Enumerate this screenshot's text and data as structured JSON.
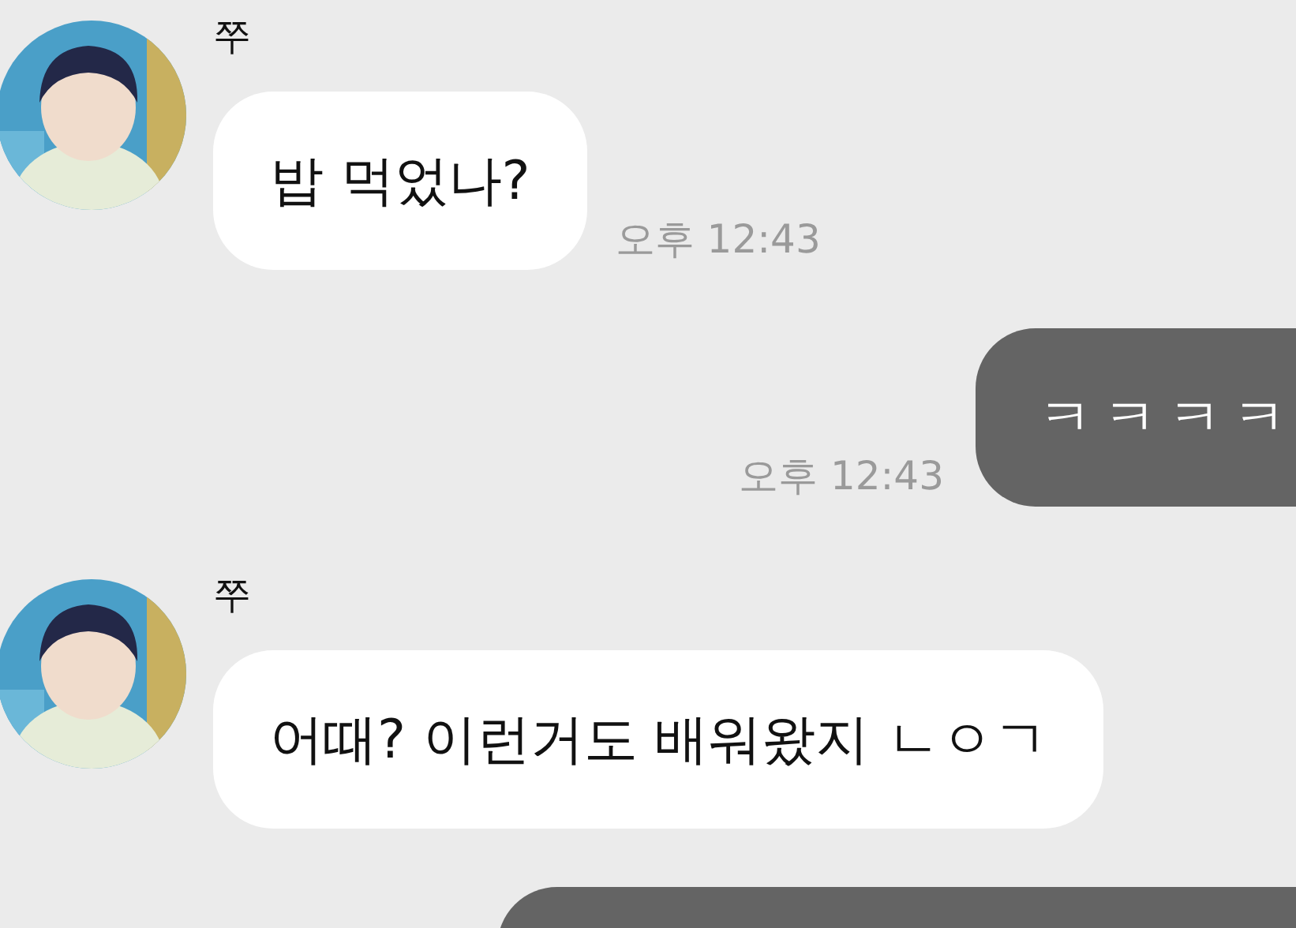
{
  "messages": [
    {
      "kind": "received",
      "sender": "쭈",
      "text": "밥 먹었나?",
      "time": "오후 12:43"
    },
    {
      "kind": "sent",
      "text": "ㅋㅋㅋㅋ",
      "time": "오후 12:43"
    },
    {
      "kind": "received",
      "sender": "쭈",
      "text": "어때? 이런거도 배워왔지 ㄴㅇㄱ"
    },
    {
      "kind": "sent-cut"
    }
  ]
}
